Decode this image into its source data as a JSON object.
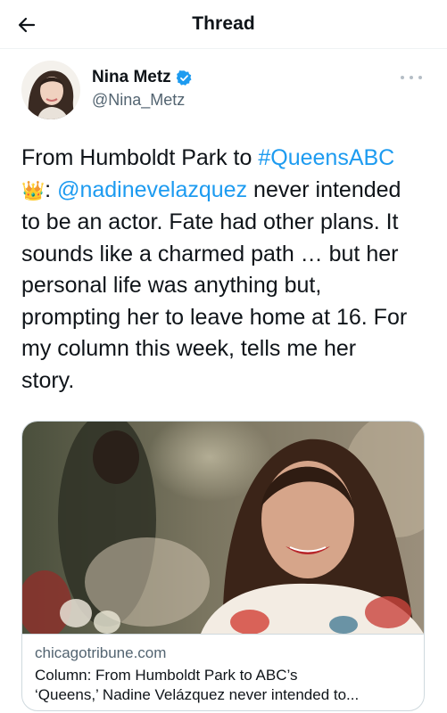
{
  "header": {
    "title": "Thread",
    "back_icon": "arrow-left-icon"
  },
  "author": {
    "display_name": "Nina Metz",
    "handle": "@Nina_Metz",
    "verified": true,
    "verified_color": "#1d9bf0",
    "more_icon": "more-dots-icon"
  },
  "tweet": {
    "segments": [
      {
        "type": "text",
        "value": "From Humboldt Park to "
      },
      {
        "type": "hashtag",
        "value": "#QueensABC"
      },
      {
        "type": "emoji",
        "value": "👑"
      },
      {
        "type": "text",
        "value": ": "
      },
      {
        "type": "mention",
        "value": "@nadinevelazquez"
      },
      {
        "type": "text",
        "value": " never intended to be an actor. Fate had other plans. It sounds like a charmed path … but her personal life was anything but, prompting her to leave home at 16. For my column this week, tells me her story."
      }
    ],
    "link_color": "#1d9bf0"
  },
  "card": {
    "domain": "chicagotribune.com",
    "title_line_1": "Column: From Humboldt Park to ABC’s",
    "title_line_2": "‘Queens,’ Nadine Velázquez never intended to..."
  }
}
